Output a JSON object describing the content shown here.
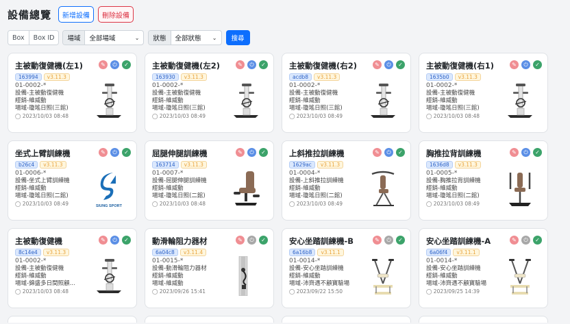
{
  "header": {
    "title": "設備總覽",
    "add_label": "新增設備",
    "delete_label": "刪除設備"
  },
  "filters": {
    "toggle": [
      "Box",
      "Box ID"
    ],
    "area_label": "場域",
    "area_value": "全部場域",
    "status_label": "狀態",
    "status_value": "全部狀態",
    "search_label": "搜尋"
  },
  "cards": [
    {
      "title": "主被動復健機(左1)",
      "id": "163994",
      "version": "v3.11.3",
      "code": "01-0002-*",
      "device": "設備-主被動復健機",
      "mode": "經銷-維威動",
      "site": "場域-瓊瑤日照(三館)",
      "date": "2023/10/03 08:48",
      "image": "bike",
      "power": "on"
    },
    {
      "title": "主被動復健機(左2)",
      "id": "163930",
      "version": "v3.11.3",
      "code": "01-0002-*",
      "device": "設備-主被動復健機",
      "mode": "經銷-維威動",
      "site": "場域-瓊瑤日照(三館)",
      "date": "2023/10/03 08:49",
      "image": "bike",
      "power": "on"
    },
    {
      "title": "主被動復健機(右2)",
      "id": "acdb8",
      "version": "v3.11.3",
      "code": "01-0002-*",
      "device": "設備-主被動復健機",
      "mode": "經銷-維威動",
      "site": "場域-瓊瑤日照(三館)",
      "date": "2023/10/03 08:49",
      "image": "bike",
      "power": "on"
    },
    {
      "title": "主被動復健機(右1)",
      "id": "1635b0",
      "version": "v3.11.3",
      "code": "01-0002-*",
      "device": "設備-主被動復健機",
      "mode": "經銷-維威動",
      "site": "場域-瓊瑤日照(三館)",
      "date": "2023/10/03 08:48",
      "image": "bike",
      "power": "on"
    },
    {
      "title": "坐式上臂訓練機",
      "id": "b26c4",
      "version": "v3.11.3",
      "code": "01-0006-*",
      "device": "設備-坐式上臂訓練機",
      "mode": "經銷-維威動",
      "site": "場域-瓊瑤日照(二館)",
      "date": "2023/10/03 08:49",
      "image": "logo",
      "logo_text": "SIUNG SPORT",
      "power": "on"
    },
    {
      "title": "屈腿伸腿訓練機",
      "id": "163714",
      "version": "v3.11.3",
      "code": "01-0007-*",
      "device": "設備-屈腿伸腿訓練機",
      "mode": "經銷-維威動",
      "site": "場域-瓊瑤日照(二館)",
      "date": "2023/10/03 08:48",
      "image": "legchair",
      "power": "on"
    },
    {
      "title": "上斜推拉訓練機",
      "id": "1629ac",
      "version": "v3.11.3",
      "code": "01-0004-*",
      "device": "設備-上斜推拉訓練機",
      "mode": "經銷-維威動",
      "site": "場域-瓊瑤日照(二館)",
      "date": "2023/10/03 08:49",
      "image": "incline",
      "power": "on"
    },
    {
      "title": "胸推拉背訓練機",
      "id": "1636d8",
      "version": "v3.11.3",
      "code": "01-0005-*",
      "device": "設備-胸推拉背訓練機",
      "mode": "經銷-維威動",
      "site": "場域-瓊瑤日照(二館)",
      "date": "2023/10/03 08:49",
      "image": "chest",
      "power": "on"
    },
    {
      "title": "主被動復健機",
      "id": "8c14e4",
      "version": "v3.11.3",
      "code": "01-0002-*",
      "device": "設備-主被動復健機",
      "mode": "經銷-維威動",
      "site": "場域-錦盛多日間照顧...",
      "date": "2023/10/03 08:48",
      "image": "bike",
      "power": "on"
    },
    {
      "title": "動滑輪阻力器材",
      "id": "6a04c8",
      "version": "v3.11.4",
      "code": "01-0015-*",
      "device": "設備-動滑輪阻力器材",
      "mode": "經銷-維威動",
      "site": "場域-維威動",
      "date": "2023/09/26 15:41",
      "image": "pulley",
      "power": "off"
    },
    {
      "title": "安心坐踏訓練機-B",
      "id": "6a16b8",
      "version": "v3.11.1",
      "code": "01-0014-*",
      "device": "設備-安心坐踏訓練機",
      "mode": "經銷-維威動",
      "site": "場域-沛齊遇不顧寶驗場",
      "date": "2023/09/22 15:50",
      "image": "stepper",
      "power": "off"
    },
    {
      "title": "安心坐踏訓練機-A",
      "id": "6a06f4",
      "version": "v3.11.1",
      "code": "01-0014-*",
      "device": "設備-安心坐踏訓練機",
      "mode": "經銷-維威動",
      "site": "場域-沛齊遇不顧寶驗場",
      "date": "2023/09/25 14:39",
      "image": "stepper",
      "power": "off"
    }
  ],
  "icons": {
    "edit": "pencil-icon",
    "power": "power-icon",
    "status": "check-icon",
    "date": "clock-icon"
  },
  "colors": {
    "primary": "#0d6efd",
    "danger": "#dc3545",
    "success": "#3ca36a",
    "edit": "#f08e93",
    "power_on": "#5b8fe6",
    "power_off": "#a8a8a8"
  }
}
